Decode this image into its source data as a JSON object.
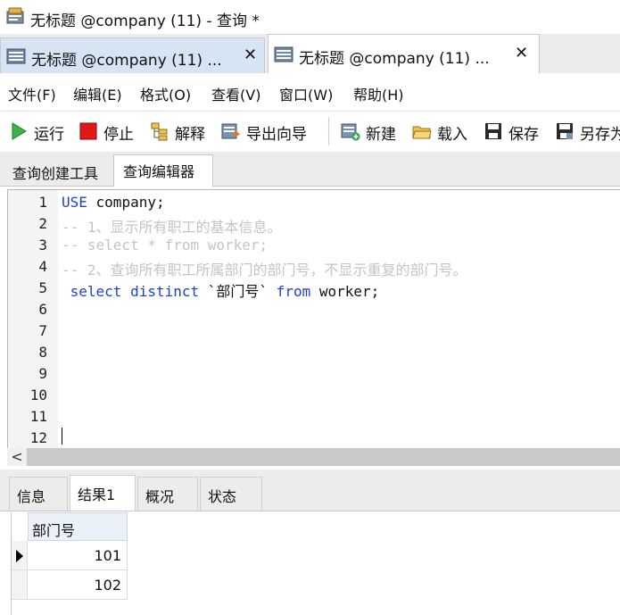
{
  "window": {
    "title": "无标题 @company (11) - 查询 *"
  },
  "doc_tabs": [
    {
      "label": "无标题 @company (11) ...",
      "close": "✕"
    },
    {
      "label": "无标题 @company (11) ...",
      "close": "✕"
    }
  ],
  "menu": [
    "文件(F)",
    "编辑(E)",
    "格式(O)",
    "查看(V)",
    "窗口(W)",
    "帮助(H)"
  ],
  "toolbar": {
    "run": "运行",
    "stop": "停止",
    "explain": "解释",
    "export_wizard": "导出向导",
    "new": "新建",
    "load": "载入",
    "save": "保存",
    "save_as": "另存为"
  },
  "mode_tabs": [
    "查询创建工具",
    "查询编辑器"
  ],
  "editor": {
    "line_numbers": [
      "1",
      "2",
      "3",
      "4",
      "5",
      "6",
      "7",
      "8",
      "9",
      "10",
      "11",
      "12"
    ],
    "line1": {
      "kw": "USE",
      "rest": " company;"
    },
    "line2": "-- 1、显示所有职工的基本信息。",
    "line3": "-- select * from worker;",
    "line4": "-- 2、查询所有职工所属部门的部门号，不显示重复的部门号。",
    "line5": {
      "kw1": " select distinct ",
      "col": "`部门号`",
      "kw2": " from",
      "rest": " worker;"
    }
  },
  "scrollbar": {
    "left_arrow": "<"
  },
  "result_tabs": [
    "信息",
    "结果1",
    "概况",
    "状态"
  ],
  "grid": {
    "column": "部门号",
    "rows": [
      "101",
      "102"
    ]
  },
  "colors": {
    "keyword": "#1f3fcf",
    "comment": "#c4c4c4",
    "active_doc_tab": "#d6e4f3"
  }
}
